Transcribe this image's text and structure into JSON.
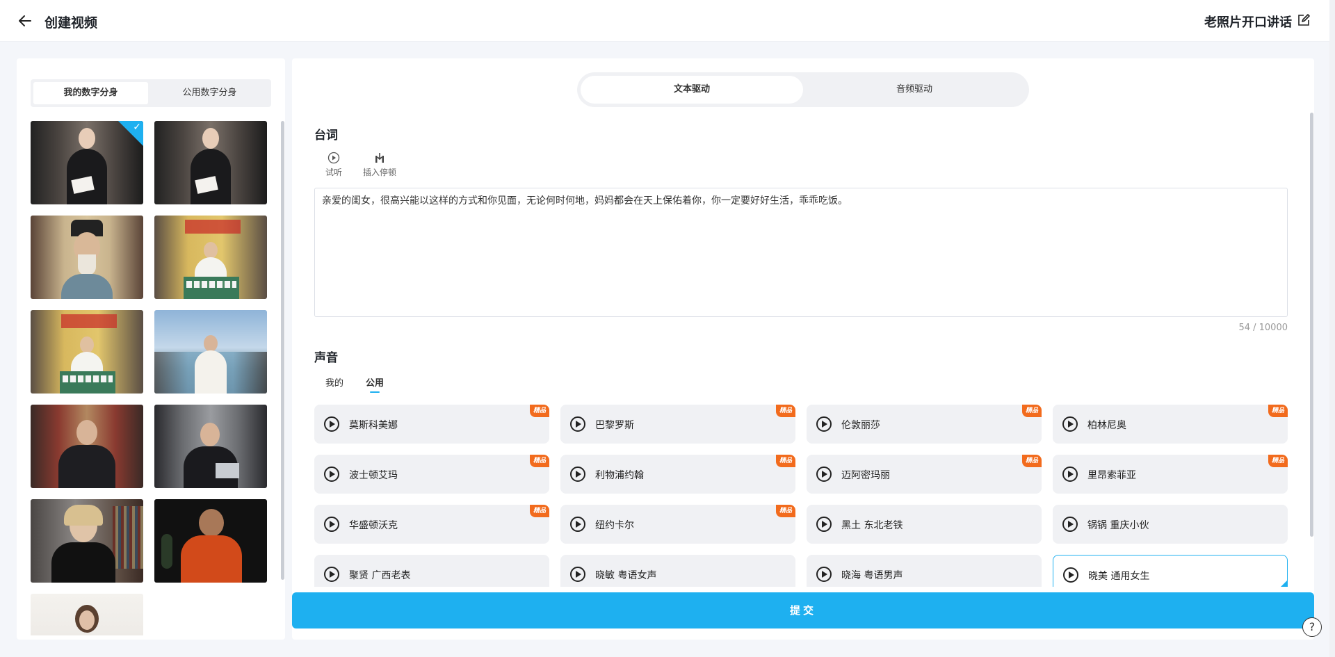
{
  "header": {
    "back_label": "back",
    "title": "创建视频",
    "project_title": "老照片开口讲话"
  },
  "avatar_panel": {
    "tabs": [
      {
        "label": "我的数字分身",
        "active": true
      },
      {
        "label": "公用数字分身",
        "active": false
      }
    ],
    "selected_index": 0
  },
  "main": {
    "mode_tabs": [
      {
        "label": "文本驱动",
        "active": true
      },
      {
        "label": "音频驱动",
        "active": false
      }
    ],
    "script_section": {
      "title": "台词",
      "tools": [
        {
          "label": "试听",
          "icon": "play-circle-icon"
        },
        {
          "label": "插入停顿",
          "icon": "insert-pause-icon"
        }
      ],
      "text": "亲爱的闺女，很高兴能以这样的方式和你见面，无论何时何地，妈妈都会在天上保佑着你，你一定要好好生活，乖乖吃饭。",
      "counter": "54 / 10000"
    },
    "voice_section": {
      "title": "声音",
      "tabs": [
        {
          "label": "我的",
          "active": false
        },
        {
          "label": "公用",
          "active": true
        }
      ],
      "badge_label": "精品",
      "voices": [
        {
          "name": "莫斯科美娜",
          "premium": true
        },
        {
          "name": "巴黎罗斯",
          "premium": true
        },
        {
          "name": "伦敦丽莎",
          "premium": true
        },
        {
          "name": "柏林尼奥",
          "premium": true
        },
        {
          "name": "波士顿艾玛",
          "premium": true
        },
        {
          "name": "利物浦约翰",
          "premium": true
        },
        {
          "name": "迈阿密玛丽",
          "premium": true
        },
        {
          "name": "里昂索菲亚",
          "premium": true
        },
        {
          "name": "华盛顿沃克",
          "premium": true
        },
        {
          "name": "纽约卡尔",
          "premium": true
        },
        {
          "name": "黑土 东北老铁",
          "premium": false
        },
        {
          "name": "锅锅 重庆小伙",
          "premium": false
        },
        {
          "name": "聚贤 广西老表",
          "premium": false
        },
        {
          "name": "晓敏 粤语女声",
          "premium": false
        },
        {
          "name": "晓海 粤语男声",
          "premium": false
        },
        {
          "name": "晓美 通用女生",
          "premium": false,
          "selected": true
        }
      ]
    },
    "submit_label": "提交",
    "help_label": "?"
  },
  "colors": {
    "accent": "#1eb0f0",
    "badge": "#f26b1d"
  }
}
